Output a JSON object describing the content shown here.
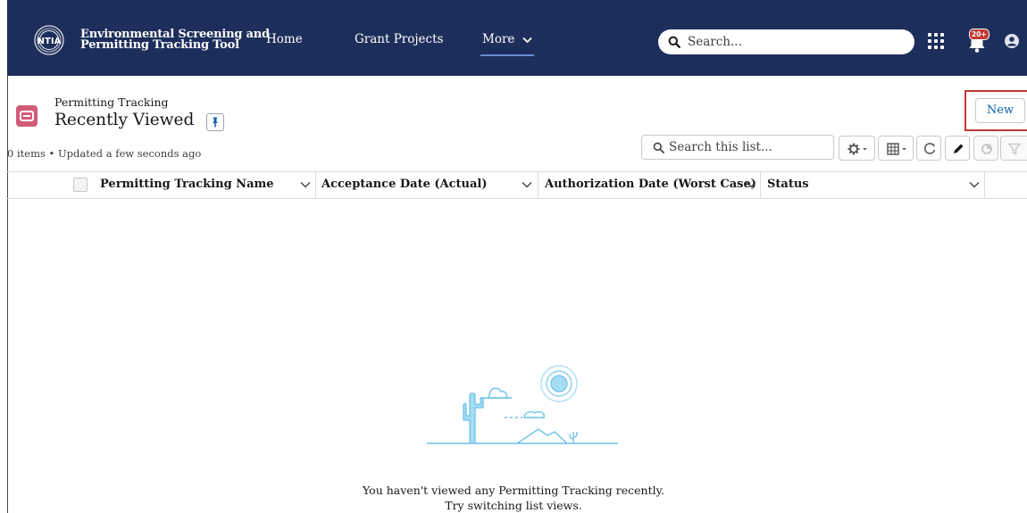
{
  "header": {
    "logo_text": "NTIA",
    "app_title_line1": "Environmental Screening and",
    "app_title_line2": "Permitting Tracking Tool",
    "nav": {
      "home": "Home",
      "grant_projects": "Grant Projects",
      "more": "More"
    },
    "search_placeholder": "Search...",
    "notification_badge": "20+",
    "colors": {
      "bar": "#1d2e5b",
      "active_underline": "#6b8ad6",
      "badge": "#c23934"
    }
  },
  "list_view": {
    "object_label": "Permitting Tracking",
    "view_name": "Recently Viewed",
    "meta": "0 items • Updated a few seconds ago",
    "new_button": "New",
    "search_placeholder": "Search this list...",
    "object_icon_color": "#d35b7a"
  },
  "table": {
    "columns": [
      "Permitting Tracking Name",
      "Acceptance Date (Actual)",
      "Authorization Date (Worst Case)",
      "Status"
    ],
    "rows": []
  },
  "empty_state": {
    "line1": "You haven't viewed any Permitting Tracking recently.",
    "line2": "Try switching list views."
  },
  "toolbar_icons": [
    "gear-icon",
    "table-display-icon",
    "refresh-icon",
    "edit-pencil-icon",
    "chart-icon",
    "filter-icon"
  ]
}
